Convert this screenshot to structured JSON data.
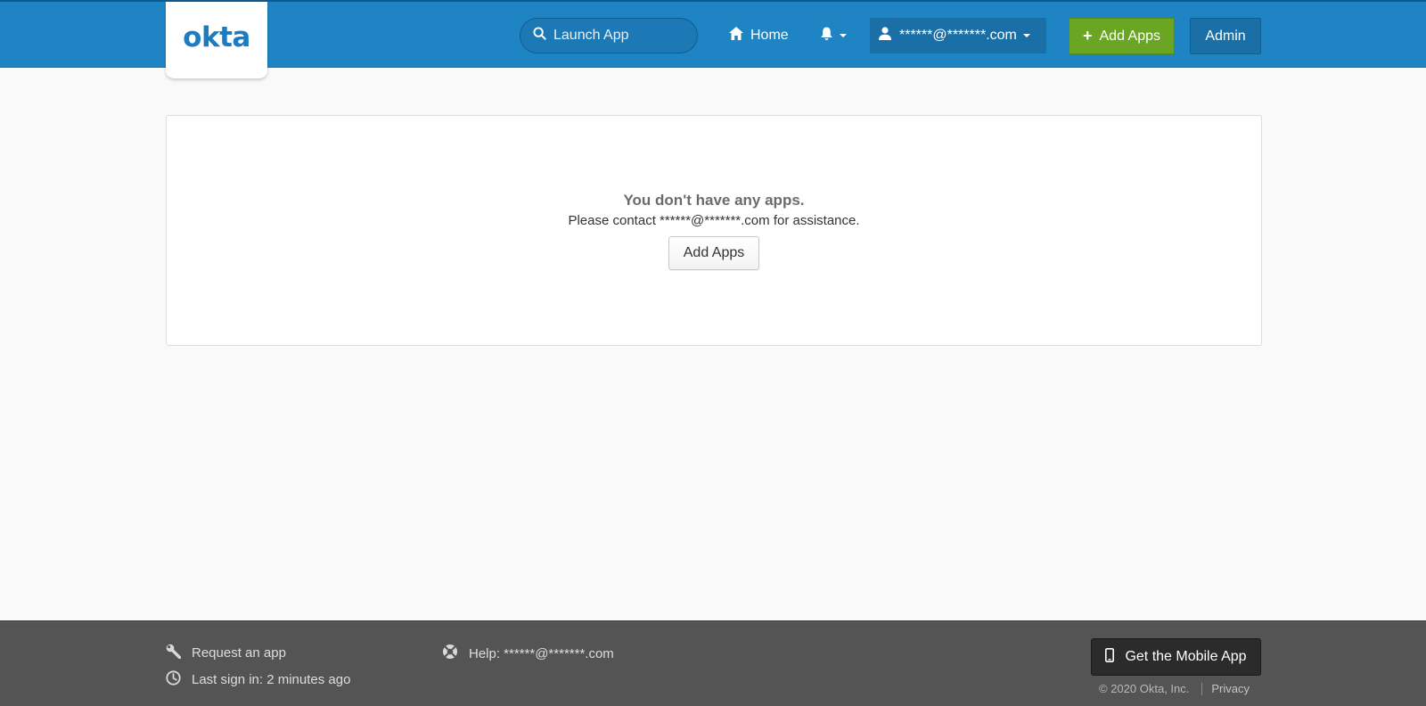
{
  "header": {
    "logo_text": "okta",
    "search": {
      "placeholder": "Launch App",
      "icon": "search-icon"
    },
    "home_label": "Home",
    "home_icon": "home-icon",
    "bell_icon": "bell-icon",
    "user_label": "******@*******.com",
    "user_icon": "user-icon",
    "add_apps_label": "Add Apps",
    "admin_label": "Admin",
    "colors": {
      "bar": "#1f84c3",
      "add_apps": "#6aa623"
    }
  },
  "main": {
    "empty_title": "You don't have any apps.",
    "empty_subtitle": "Please contact ******@*******.com for assistance.",
    "add_apps_button": "Add Apps"
  },
  "footer": {
    "request_app": "Request an app",
    "request_icon": "wrench-icon",
    "last_sign_in": "Last sign in: 2 minutes ago",
    "last_sign_icon": "clock-icon",
    "help": "Help: ******@*******.com",
    "help_icon": "lifebuoy-icon",
    "mobile_app_button": "Get the Mobile App",
    "mobile_icon": "phone-icon",
    "copyright": "© 2020 Okta, Inc.",
    "privacy": "Privacy"
  }
}
